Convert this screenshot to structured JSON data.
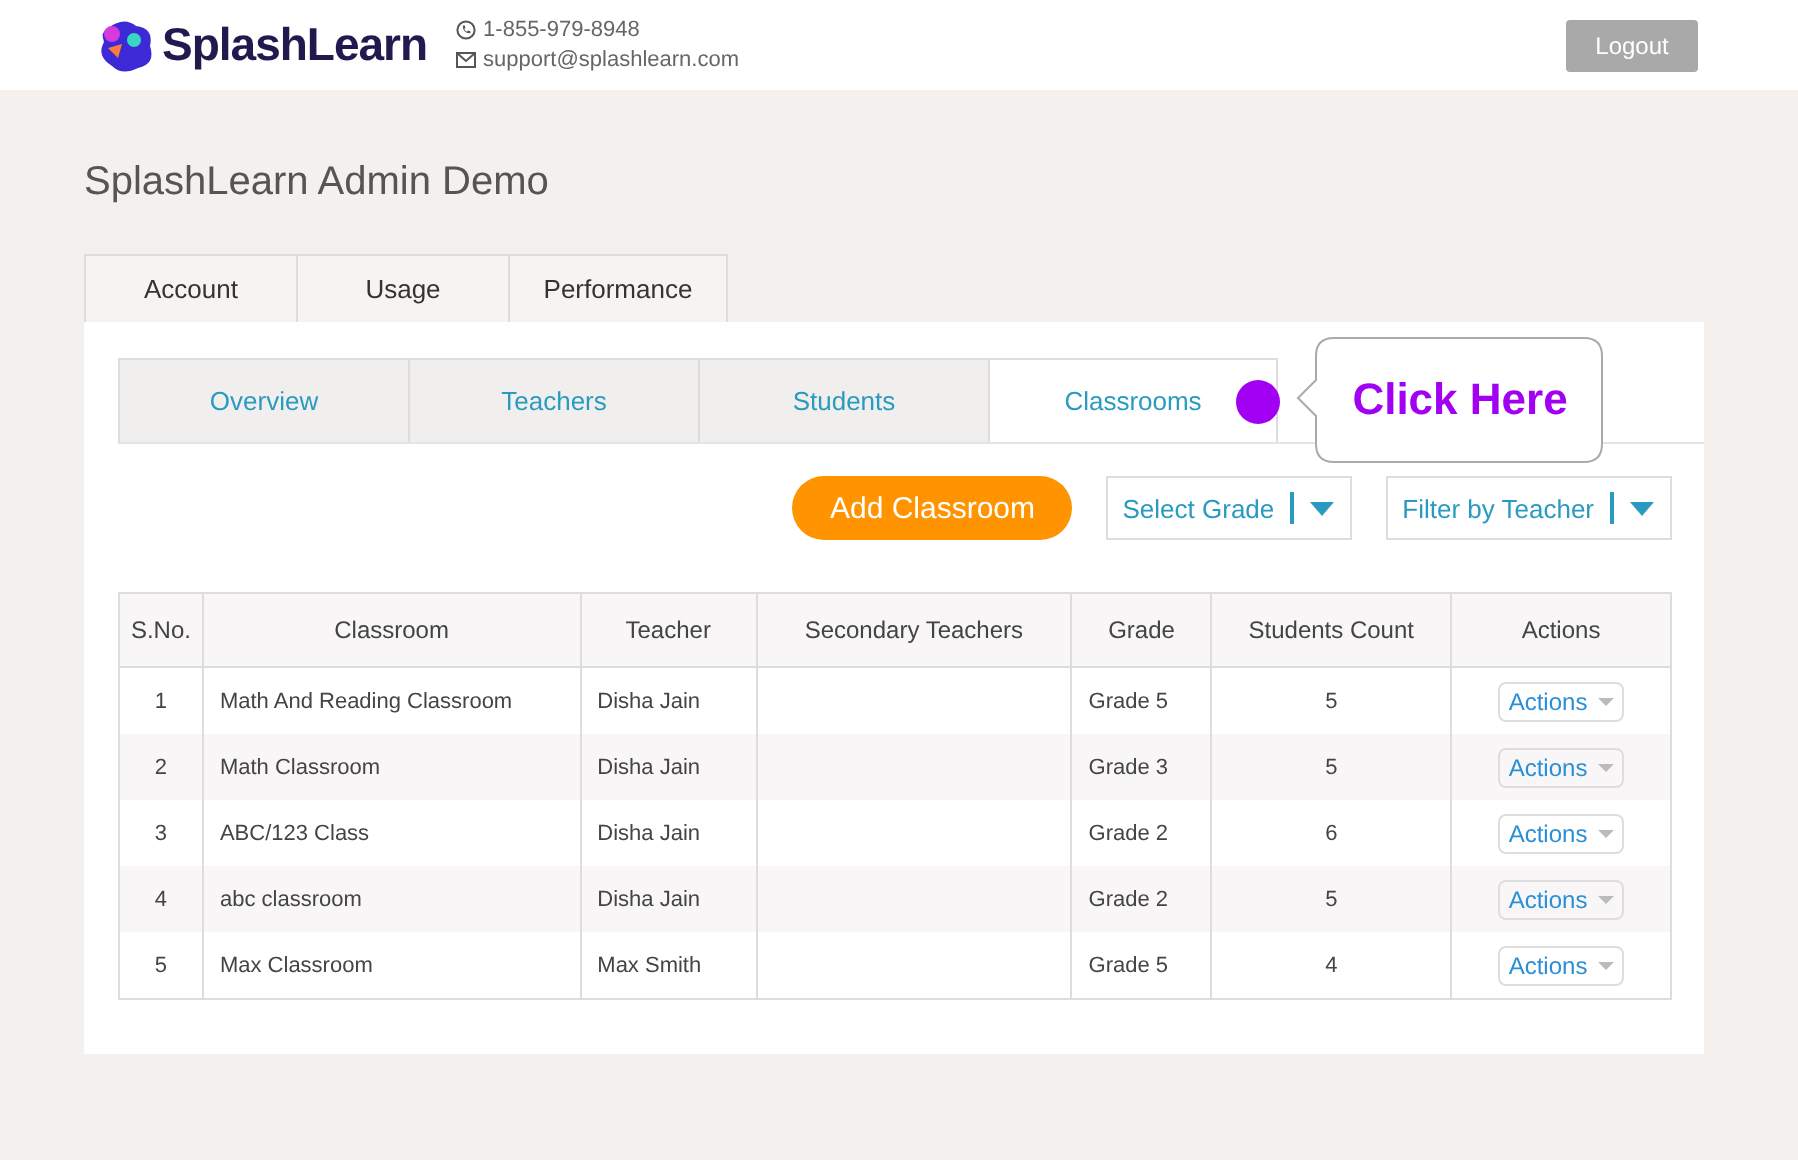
{
  "header": {
    "brand": "SplashLearn",
    "phone": "1-855-979-8948",
    "email": "support@splashlearn.com",
    "logout": "Logout"
  },
  "page_title": "SplashLearn Admin Demo",
  "main_tabs": [
    {
      "label": "Account",
      "selected": false
    },
    {
      "label": "Usage",
      "selected": false
    },
    {
      "label": "Performance",
      "selected": false
    }
  ],
  "sub_tabs": [
    {
      "label": "Overview",
      "selected": false
    },
    {
      "label": "Teachers",
      "selected": false
    },
    {
      "label": "Students",
      "selected": false
    },
    {
      "label": "Classrooms",
      "selected": true
    }
  ],
  "callout": "Click Here",
  "toolbar": {
    "add_button": "Add Classroom",
    "grade_filter": "Select Grade",
    "teacher_filter": "Filter by Teacher"
  },
  "table": {
    "columns": [
      "S.No.",
      "Classroom",
      "Teacher",
      "Secondary Teachers",
      "Grade",
      "Students Count",
      "Actions"
    ],
    "rows": [
      {
        "sno": "1",
        "classroom": "Math And Reading Classroom",
        "teacher": "Disha Jain",
        "grade": "Grade 5",
        "count": "5",
        "action": "Actions"
      },
      {
        "sno": "2",
        "classroom": "Math Classroom",
        "teacher": "Disha Jain",
        "grade": "Grade 3",
        "count": "5",
        "action": "Actions"
      },
      {
        "sno": "3",
        "classroom": "ABC/123 Class",
        "teacher": "Disha Jain",
        "grade": "Grade 2",
        "count": "6",
        "action": "Actions"
      },
      {
        "sno": "4",
        "classroom": "abc classroom",
        "teacher": "Disha Jain",
        "grade": "Grade 2",
        "count": "5",
        "action": "Actions"
      },
      {
        "sno": "5",
        "classroom": "Max Classroom",
        "teacher": "Max Smith",
        "grade": "Grade 5",
        "count": "4",
        "action": "Actions"
      }
    ]
  }
}
